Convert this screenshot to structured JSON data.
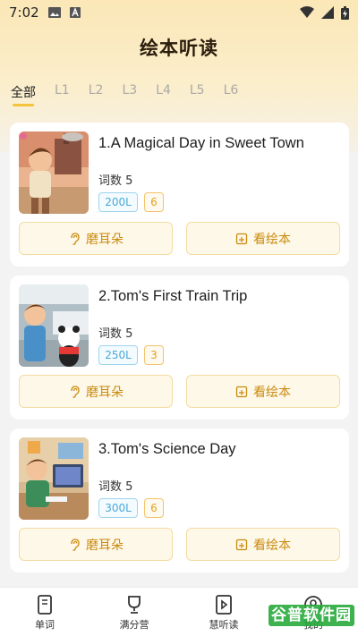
{
  "status_bar": {
    "time": "7:02"
  },
  "header": {
    "title": "绘本听读"
  },
  "tabs": [
    {
      "label": "全部",
      "active": true
    },
    {
      "label": "L1"
    },
    {
      "label": "L2"
    },
    {
      "label": "L3"
    },
    {
      "label": "L4"
    },
    {
      "label": "L5"
    },
    {
      "label": "L6"
    }
  ],
  "books": [
    {
      "title": "1.A Magical Day in Sweet Town",
      "word_count": "词数 5",
      "level": "200L",
      "count": "6",
      "listen_label": "磨耳朵",
      "read_label": "看绘本"
    },
    {
      "title": "2.Tom's First Train Trip",
      "word_count": "词数 5",
      "level": "250L",
      "count": "3",
      "listen_label": "磨耳朵",
      "read_label": "看绘本"
    },
    {
      "title": "3.Tom's Science Day",
      "word_count": "词数 5",
      "level": "300L",
      "count": "6",
      "listen_label": "磨耳朵",
      "read_label": "看绘本"
    }
  ],
  "bottom_nav": [
    {
      "label": "单词",
      "icon": "book-icon"
    },
    {
      "label": "满分营",
      "icon": "trophy-icon"
    },
    {
      "label": "慧听读",
      "icon": "play-book-icon"
    },
    {
      "label": "我的",
      "icon": "profile-icon"
    }
  ],
  "watermark": "谷普软件园",
  "colors": {
    "accent": "#f4c53a",
    "button_text": "#c98a0d",
    "level_blue": "#49a9d6"
  }
}
